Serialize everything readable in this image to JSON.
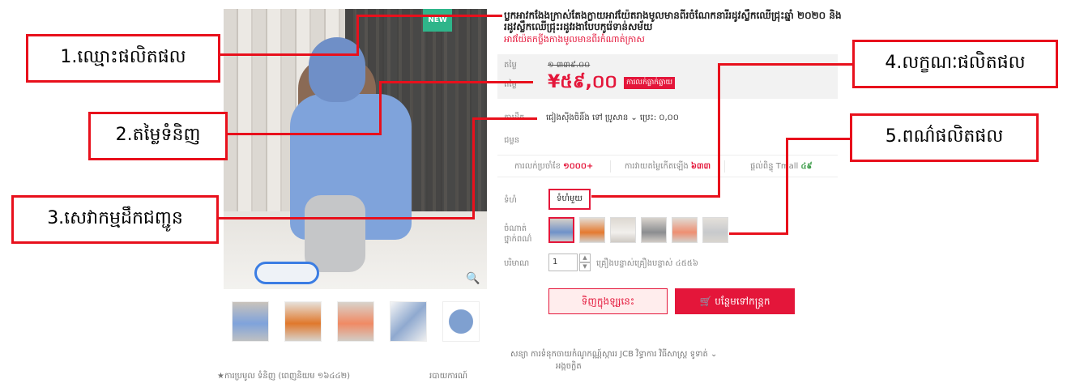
{
  "product": {
    "badge": "NEW",
    "title": "ប្លកអាវកងែងក្រាស់តែងក្លាយអាវយ៉ែតរាងមូលមានពីរចំណែកនារីរដូវស្លឹកឈើជ្រុះឆ្នាំ ២០២០ និងរដូវស្លឹកឈើជ្រុះរដូវរងាបែបកូរ៉េទាន់សម័យ",
    "promo_text": "អាវយ៉ែតកច្លីងកាងមូលមានពីរកំណាត់ក្រាស",
    "price_label": "តម្លៃ",
    "original_price": "១ ៣៣៩.០០",
    "sale_label": "តម្លៃ",
    "sale_price": "¥៥៩,០០",
    "promo_tag": "ការលក់ធ្លាក់ឆ្លាយ",
    "ship_label": "ការដឹក",
    "ship_info": "ជៀងស៊ីងចិនិ៍ង ទៅ ប្រូសាន ⌄ ប្រេះ: ០,០០",
    "promise_label": "ជម្លន",
    "stats": [
      {
        "label": "ការលក់ប្រចាំខែ",
        "value": "១០០០+"
      },
      {
        "label": "ការវាយតម្លៃកើតឡើង",
        "value": "៦៣៣"
      },
      {
        "label": "ផ្តល់ពិន្ទុ Tmall",
        "value": "៤៩"
      }
    ],
    "size_label": "ទំហំ",
    "size_value": "ទំហំមួយ",
    "color_label": "ចំណាត់ថ្នាក់ពណ៌",
    "qty_label": "បរិមាណ",
    "qty_value": "1",
    "stock_text": "គ្រឿងបន្ទាស់គ្រឿងបន្ទាស់ ៤៥៥៦",
    "buy_now": "ទិញក្នុងឡ្សនេះ",
    "add_cart": "🛒 បន្ថែមទៅកន្ត្រក",
    "payment_row": "សន្យា   ការទំនុកចាយកំណូកណ្ណ៍ស្ការរ   JCB   វិទ្ធាការ          វិធីសាស្រ្ត ទូទាត់ ⌄",
    "payment_row2": "អង្កចក្លិត",
    "favorite": "★ការប្រមូល ទំនិញ (ពេញនិយម ១៦៤៤២)",
    "report": "របាយការណ៍",
    "zoom": "🔍"
  },
  "annotations": {
    "a1": "1.ឈ្មោះផលិតផល",
    "a2": "2.តម្លៃទំនិញ",
    "a3": "3.សេវាកម្មដឹកជញ្ជូន",
    "a4": "4.លក្ខណៈផលិតផល",
    "a5": "5.ពណ៌ផលិតផល"
  },
  "colors": {
    "accent": "#e8101c",
    "brand_red": "#e4163a",
    "badge_green": "#2fb58a"
  }
}
